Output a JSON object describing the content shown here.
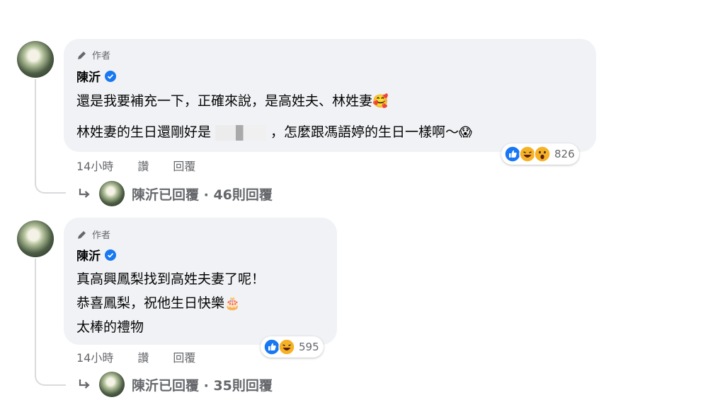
{
  "comments": [
    {
      "author_badge": "作者",
      "author": "陳沂",
      "lines": [
        {
          "text": "還是我要補充一下，正確來說，是高姓夫、林姓妻",
          "emoji": "🥰"
        },
        {
          "text_before": "林姓妻的生日還剛好是",
          "text_after": "，怎麼跟馮語婷的生日一樣啊～",
          "emoji": "😱"
        }
      ],
      "time": "14小時",
      "like_label": "讚",
      "reply_label": "回覆",
      "reactions": {
        "icons": [
          "like-icon",
          "haha-icon",
          "wow-icon"
        ],
        "count": "826"
      },
      "replies_text": "陳沂已回覆 · 46則回覆"
    },
    {
      "author_badge": "作者",
      "author": "陳沂",
      "lines": [
        {
          "text": "真高興鳳梨找到高姓夫妻了呢！"
        },
        {
          "text": "恭喜鳳梨，祝他生日快樂",
          "emoji": "🎂"
        },
        {
          "text": "太棒的禮物"
        }
      ],
      "time": "14小時",
      "like_label": "讚",
      "reply_label": "回覆",
      "reactions": {
        "icons": [
          "like-icon",
          "haha-icon"
        ],
        "count": "595"
      },
      "replies_text": "陳沂已回覆 · 35則回覆"
    }
  ],
  "colors": {
    "fb_blue": "#1877f2",
    "bubble": "#f0f2f5",
    "meta": "#65676b"
  }
}
